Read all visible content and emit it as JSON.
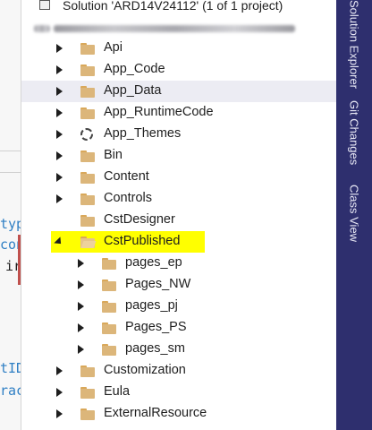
{
  "solution": {
    "label": "Solution 'ARD14V24112' (1 of 1 project)"
  },
  "side_tabs": [
    {
      "label": "Solution Explorer"
    },
    {
      "label": "Git Changes"
    },
    {
      "label": "Class View"
    }
  ],
  "editor_fragments": [
    "typ",
    "con",
    "ir",
    "tID",
    "rac"
  ],
  "tree": [
    {
      "label": "Api",
      "level": 1,
      "expanded": false,
      "icon": "folder-icon"
    },
    {
      "label": "App_Code",
      "level": 1,
      "expanded": false,
      "icon": "folder-icon"
    },
    {
      "label": "App_Data",
      "level": 1,
      "expanded": false,
      "icon": "folder-icon"
    },
    {
      "label": "App_RuntimeCode",
      "level": 1,
      "expanded": false,
      "icon": "folder-icon"
    },
    {
      "label": "App_Themes",
      "level": 1,
      "expanded": false,
      "icon": "gear-icon"
    },
    {
      "label": "Bin",
      "level": 1,
      "expanded": false,
      "icon": "folder-icon"
    },
    {
      "label": "Content",
      "level": 1,
      "expanded": false,
      "icon": "folder-icon"
    },
    {
      "label": "Controls",
      "level": 1,
      "expanded": false,
      "icon": "folder-icon"
    },
    {
      "label": "CstDesigner",
      "level": 1,
      "expanded": null,
      "icon": "folder-icon"
    },
    {
      "label": "CstPublished",
      "level": 1,
      "expanded": true,
      "icon": "folder-open-icon"
    },
    {
      "label": "pages_ep",
      "level": 2,
      "expanded": false,
      "icon": "folder-icon"
    },
    {
      "label": "Pages_NW",
      "level": 2,
      "expanded": false,
      "icon": "folder-icon"
    },
    {
      "label": "pages_pj",
      "level": 2,
      "expanded": false,
      "icon": "folder-icon"
    },
    {
      "label": "Pages_PS",
      "level": 2,
      "expanded": false,
      "icon": "folder-icon"
    },
    {
      "label": "pages_sm",
      "level": 2,
      "expanded": false,
      "icon": "folder-icon"
    },
    {
      "label": "Customization",
      "level": 1,
      "expanded": false,
      "icon": "folder-icon"
    },
    {
      "label": "Eula",
      "level": 1,
      "expanded": false,
      "icon": "folder-icon"
    },
    {
      "label": "ExternalResource",
      "level": 1,
      "expanded": false,
      "icon": "folder-icon"
    }
  ],
  "colors": {
    "sidebar": "#2e2f6e",
    "highlight": "#ffff00",
    "hover": "#ececf3"
  }
}
